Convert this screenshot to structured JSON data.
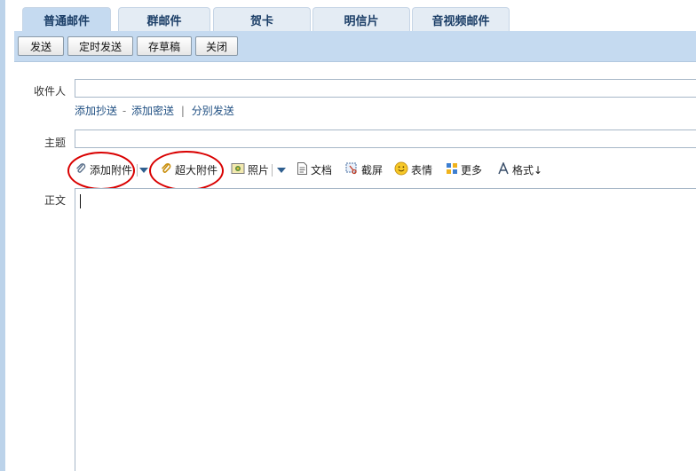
{
  "tabs": [
    {
      "label": "普通邮件",
      "active": true
    },
    {
      "label": "群邮件",
      "active": false
    },
    {
      "label": "贺卡",
      "active": false
    },
    {
      "label": "明信片",
      "active": false
    },
    {
      "label": "音视频邮件",
      "active": false
    }
  ],
  "toolbar": {
    "send": "发送",
    "timed_send": "定时发送",
    "save_draft": "存草稿",
    "close": "关闭"
  },
  "form": {
    "recipient_label": "收件人",
    "recipient_value": "",
    "links": {
      "add_cc": "添加抄送",
      "dash": "-",
      "add_bcc": "添加密送",
      "pipe": "|",
      "separate_send": "分别发送"
    },
    "subject_label": "主题",
    "subject_value": "",
    "body_label": "正文"
  },
  "attach_toolbar": {
    "add_attachment": "添加附件",
    "large_attachment": "超大附件",
    "photo": "照片",
    "document": "文档",
    "screenshot": "截屏",
    "emoji": "表情",
    "more": "更多",
    "format": "格式↓"
  },
  "colors": {
    "toolbar_bg": "#c5daf0",
    "tab_bg": "#e4ecf4",
    "link": "#1f4f82",
    "highlight_ring": "#d90000"
  }
}
